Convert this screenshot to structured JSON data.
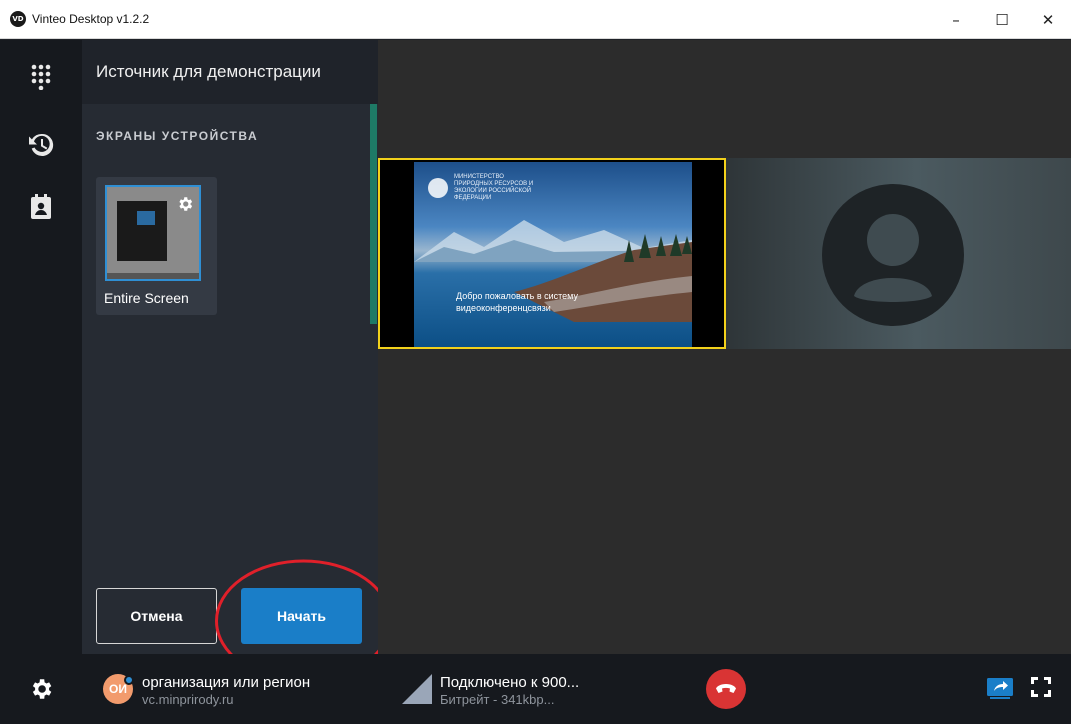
{
  "window": {
    "app_icon_text": "VD",
    "title": "Vinteo Desktop v1.2.2",
    "controls": {
      "minimize": "–",
      "maximize": "☐",
      "close": "✕"
    }
  },
  "rail": {
    "items": [
      {
        "icon": "dialpad-icon"
      },
      {
        "icon": "history-icon"
      },
      {
        "icon": "contacts-icon"
      }
    ]
  },
  "panel": {
    "title": "Источник для демонстрации",
    "section_title": "ЭКРАНЫ УСТРОЙСТВА",
    "screens": [
      {
        "label": "Entire Screen"
      }
    ],
    "cancel_label": "Отмена",
    "start_label": "Начать"
  },
  "stage": {
    "slide_org": "МИНИСТЕРСТВО ПРИРОДНЫХ РЕСУРСОВ И ЭКОЛОГИИ РОССИЙСКОЙ ФЕДЕРАЦИИ",
    "slide_welcome": "Добро пожаловать в систему видеоконференцсвязи"
  },
  "bottombar": {
    "contact": {
      "initials": "ОИ",
      "name": "организация или регион",
      "host": "vc.minprirody.ru"
    },
    "connection": {
      "status": "Подключено к 900...",
      "bitrate": "Битрейт - 341kbp..."
    }
  },
  "colors": {
    "accent": "#1a7ec8",
    "active_video_border": "#f2d11b",
    "hangup": "#d93434",
    "highlight": "#e0202a"
  }
}
